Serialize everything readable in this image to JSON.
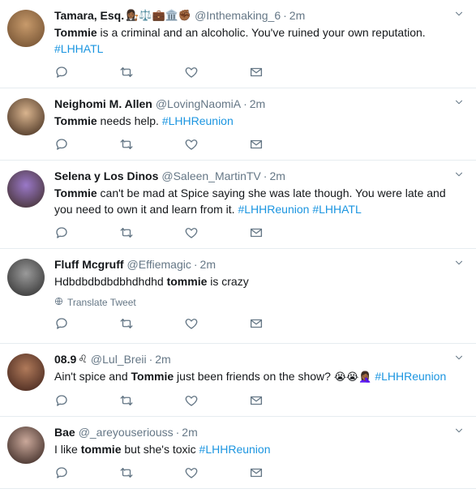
{
  "tweets": [
    {
      "name": "Tamara, Esq.",
      "name_emoji": "👩🏾‍⚖️⚖️💼🏛️✊🏾",
      "handle": "@Inthemaking_6",
      "time": "2m",
      "parts": [
        {
          "t": "b",
          "v": "Tommie"
        },
        {
          "t": "s",
          "v": " is a criminal and an alcoholic. You've ruined your own reputation."
        },
        {
          "t": "br"
        },
        {
          "t": "tag",
          "v": "#LHHATL"
        }
      ],
      "avatar_colors": [
        "#c79a6b",
        "#6b4a2c"
      ]
    },
    {
      "name": "Neighomi M. Allen",
      "name_emoji": "",
      "handle": "@LovingNaomiA",
      "time": "2m",
      "parts": [
        {
          "t": "b",
          "v": "Tommie"
        },
        {
          "t": "s",
          "v": " needs help. "
        },
        {
          "t": "tag",
          "v": "#LHHReunion"
        }
      ],
      "avatar_colors": [
        "#d9b48e",
        "#3a2618"
      ]
    },
    {
      "name": "Selena y Los Dinos",
      "name_emoji": "",
      "handle": "@Saleen_MartinTV",
      "time": "2m",
      "parts": [
        {
          "t": "b",
          "v": "Tommie"
        },
        {
          "t": "s",
          "v": " can't be mad at Spice saying she was late though. You were late and you need to own it and learn from it. "
        },
        {
          "t": "tag",
          "v": "#LHHReunion"
        },
        {
          "t": "s",
          "v": " "
        },
        {
          "t": "tag",
          "v": "#LHHATL"
        }
      ],
      "avatar_colors": [
        "#9a78c8",
        "#3b2a22"
      ]
    },
    {
      "name": "Fluff Mcgruff",
      "name_emoji": "",
      "handle": "@Effiemagic",
      "time": "2m",
      "parts": [
        {
          "t": "s",
          "v": "Hdbdbdbdbdbhdhdhd "
        },
        {
          "t": "b",
          "v": "tommie"
        },
        {
          "t": "s",
          "v": " is crazy"
        }
      ],
      "translate": "Translate Tweet",
      "avatar_colors": [
        "#9a9a9a",
        "#2a2a2a"
      ]
    },
    {
      "name": "08.9",
      "name_emoji": "♌",
      "handle": "@Lul_Breii",
      "time": "2m",
      "parts": [
        {
          "t": "s",
          "v": "Ain't spice and "
        },
        {
          "t": "b",
          "v": "Tommie"
        },
        {
          "t": "s",
          "v": " just been friends on the show? "
        },
        {
          "t": "emo",
          "v": "😭😭🤦🏾‍♀️"
        },
        {
          "t": "s",
          "v": " "
        },
        {
          "t": "tag",
          "v": "#LHHReunion"
        }
      ],
      "avatar_colors": [
        "#b07a5a",
        "#3c1f18"
      ]
    },
    {
      "name": "Bae",
      "name_emoji": "",
      "handle": "@_areyouseriouss",
      "time": "2m",
      "parts": [
        {
          "t": "s",
          "v": "I like "
        },
        {
          "t": "b",
          "v": "tommie"
        },
        {
          "t": "s",
          "v": " but she's toxic  "
        },
        {
          "t": "tag",
          "v": "#LHHReunion"
        }
      ],
      "avatar_colors": [
        "#caa89a",
        "#2e1e1a"
      ]
    }
  ],
  "icons": {
    "reply": "reply-icon",
    "retweet": "retweet-icon",
    "like": "heart-icon",
    "dm": "envelope-icon",
    "caret": "chevron-down-icon",
    "globe": "globe-icon"
  },
  "colors": {
    "link": "#1b95e0",
    "muted": "#657786",
    "text": "#14171a",
    "divider": "#e6ecf0"
  }
}
